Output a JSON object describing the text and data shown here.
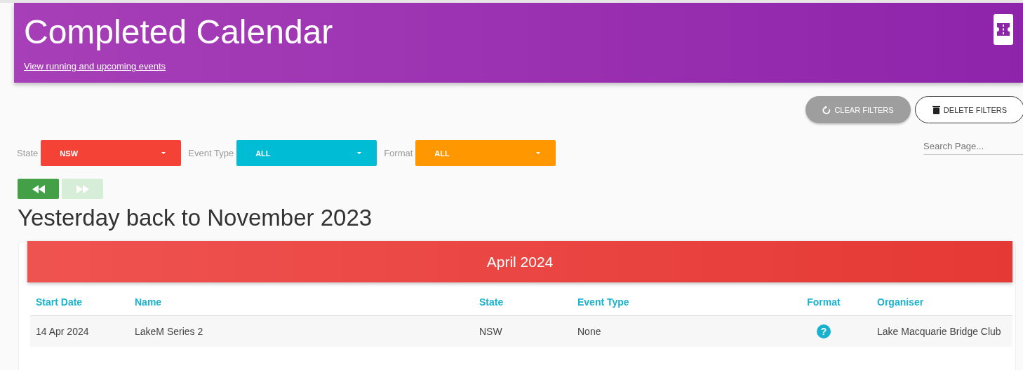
{
  "header": {
    "title": "Completed Calendar",
    "link": "View running and upcoming events"
  },
  "actions": [
    {
      "kind": "clear",
      "label": "CLEAR FILTERS"
    },
    {
      "kind": "delete",
      "label": "DELETE FILTERS"
    }
  ],
  "search": {
    "placeholder": "Search Page..."
  },
  "filters": [
    {
      "label": "State",
      "value": "NSW",
      "color": "#f44336"
    },
    {
      "label": "Event Type",
      "value": "ALL",
      "color": "#00bcd4"
    },
    {
      "label": "Format",
      "value": "ALL",
      "color": "#ff9800"
    }
  ],
  "nav": [
    {
      "kind": "back",
      "disabled": false
    },
    {
      "kind": "forward",
      "disabled": true
    }
  ],
  "heading": "Yesterday back to November 2023",
  "month": {
    "title": "April 2024",
    "columns": [
      "Start Date",
      "Name",
      "State",
      "Event Type",
      "Format",
      "Organiser"
    ],
    "rows": [
      {
        "cells": [
          "14 Apr 2024",
          "LakeM Series 2",
          "NSW",
          "None",
          "?",
          "Lake Macquarie Bridge Club"
        ]
      }
    ]
  }
}
